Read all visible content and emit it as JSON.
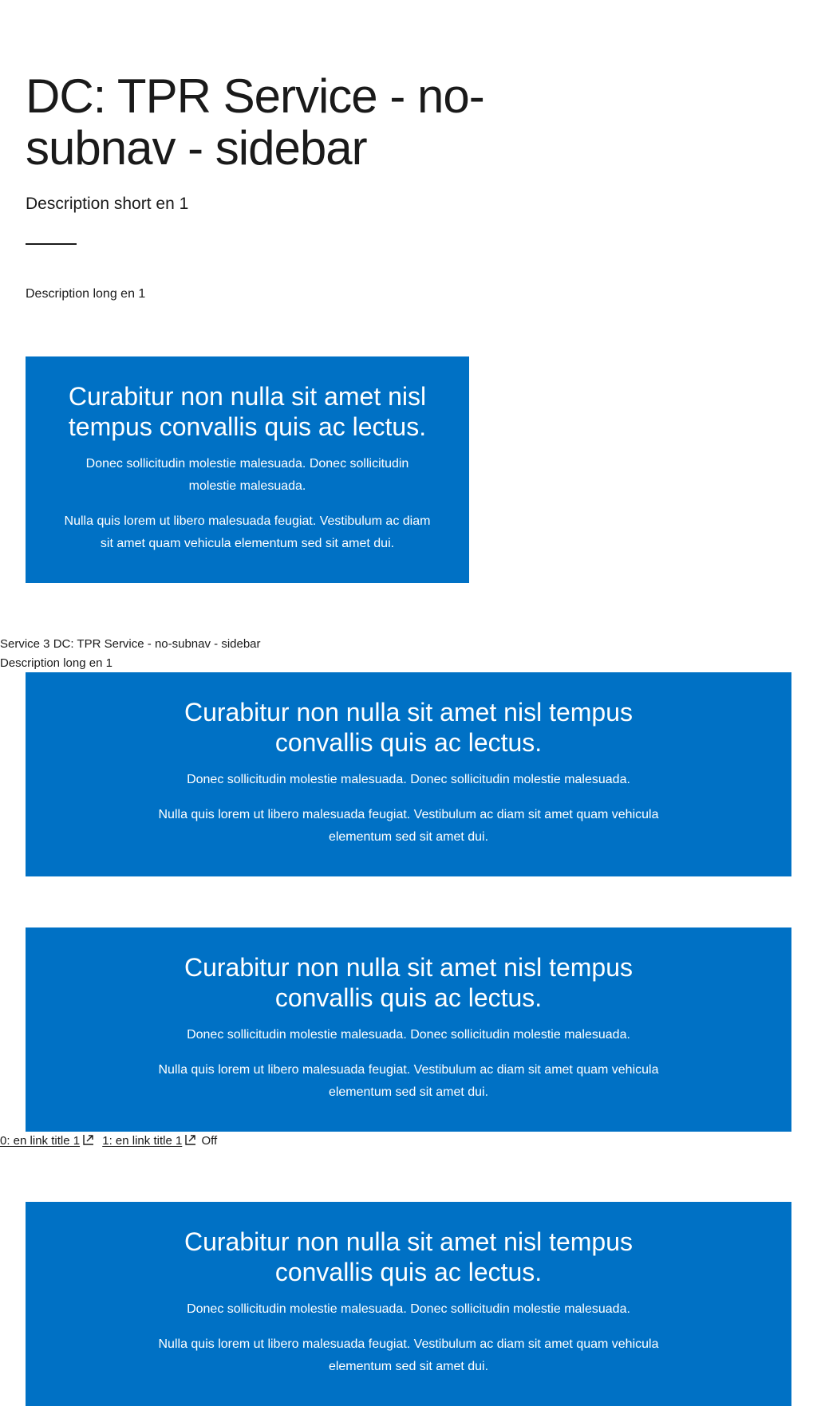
{
  "page": {
    "title": "DC: TPR Service - no-subnav - sidebar",
    "description_short": "Description short en 1",
    "description_long": "Description long en 1"
  },
  "promo_narrow": {
    "heading": "Curabitur non nulla sit amet nisl tempus convallis quis ac lectus.",
    "paragraph_1": "Donec sollicitudin molestie malesuada. Donec sollicitudin molestie malesuada.",
    "paragraph_2": "Nulla quis lorem ut libero malesuada feugiat. Vestibulum ac diam sit amet quam vehicula elementum sed sit amet dui."
  },
  "service_meta": {
    "line_1": "Service 3 DC: TPR Service - no-subnav - sidebar",
    "line_2": "Description long en 1"
  },
  "promo_wide_1": {
    "heading": "Curabitur non nulla sit amet nisl tempus convallis quis ac lectus.",
    "paragraph_1": "Donec sollicitudin molestie malesuada. Donec sollicitudin molestie malesuada.",
    "paragraph_2": "Nulla quis lorem ut libero malesuada feugiat. Vestibulum ac diam sit amet quam vehicula elementum sed sit amet dui."
  },
  "promo_wide_2": {
    "heading": "Curabitur non nulla sit amet nisl tempus convallis quis ac lectus.",
    "paragraph_1": "Donec sollicitudin molestie malesuada. Donec sollicitudin molestie malesuada.",
    "paragraph_2": "Nulla quis lorem ut libero malesuada feugiat. Vestibulum ac diam sit amet quam vehicula elementum sed sit amet dui."
  },
  "links": {
    "link_0": "0: en link title 1",
    "link_1": "1: en link title 1",
    "status": "Off",
    "icon": "external-link-icon"
  },
  "promo_wide_3": {
    "heading": "Curabitur non nulla sit amet nisl tempus convallis quis ac lectus.",
    "paragraph_1": "Donec sollicitudin molestie malesuada. Donec sollicitudin molestie malesuada.",
    "paragraph_2": "Nulla quis lorem ut libero malesuada feugiat. Vestibulum ac diam sit amet quam vehicula elementum sed sit amet dui."
  },
  "colors": {
    "promo_background": "#0071c5",
    "text": "#1a1a1a",
    "promo_text": "#ffffff"
  }
}
